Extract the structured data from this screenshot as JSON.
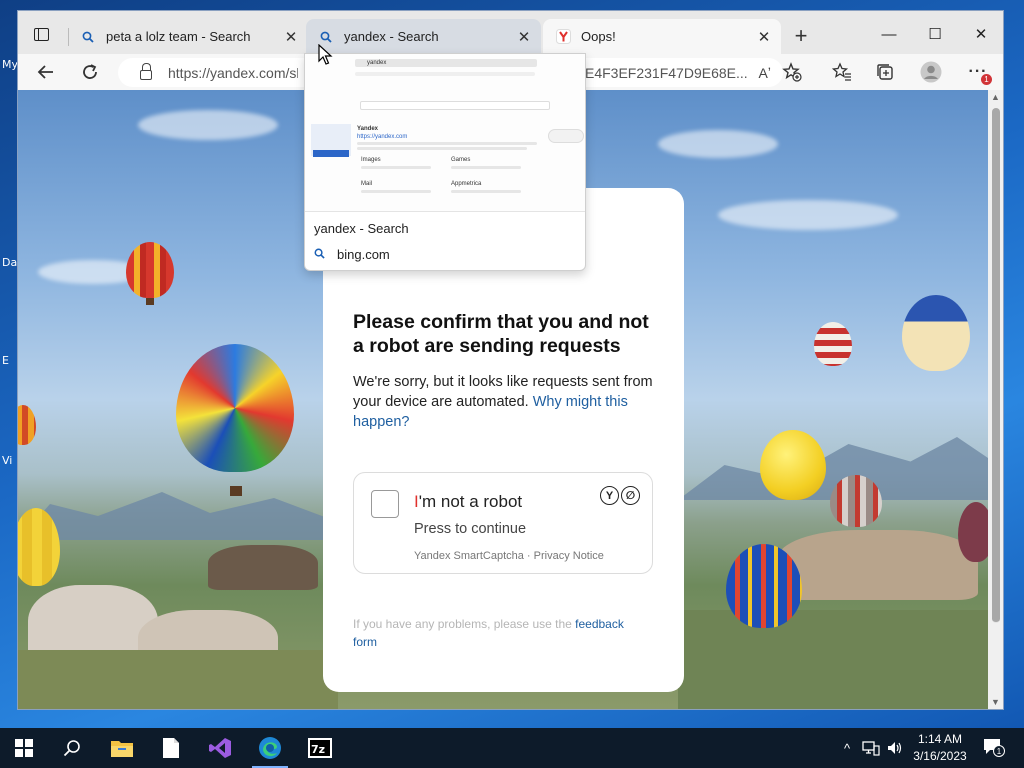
{
  "desktop": {
    "labels": [
      "My",
      "Da",
      "E",
      "Vi"
    ]
  },
  "browser": {
    "tabs": [
      {
        "title": "peta a lolz team - Search",
        "icon": "search-icon"
      },
      {
        "title": "yandex - Search",
        "icon": "search-icon"
      },
      {
        "title": "Oops!",
        "icon": "yandex-icon"
      }
    ],
    "address": {
      "url_start": "https://yandex.com/sh",
      "url_end": "E4F3EF231F47D9E68E...",
      "read_aloud": "Aʼ"
    },
    "notification_count": "1"
  },
  "preview": {
    "title": "yandex - Search",
    "url": "bing.com",
    "thumb": {
      "query": "yandex",
      "result_title": "Yandex",
      "result_url": "https://yandex.com",
      "col1_title": "Images",
      "col2_title": "Games",
      "col3_title": "Mail",
      "col4_title": "Appmetrica",
      "button": "Start Yandex"
    }
  },
  "captcha": {
    "heading": "Please confirm that you and not a robot are sending requests",
    "desc": "We're sorry, but it looks like requests sent from your device are automated.",
    "desc_link": "Why might this happen?",
    "checkbox_label_first": "I",
    "checkbox_label_rest": "'m not a robot",
    "press": "Press to continue",
    "brand": "Yandex SmartCaptcha · Privacy Notice",
    "logo_letters": [
      "Y",
      "∅"
    ],
    "feedback_text": "If you have any problems, please use the",
    "feedback_link": "feedback form"
  },
  "taskbar": {
    "time": "1:14 AM",
    "date": "3/16/2023",
    "notifications": "1"
  }
}
